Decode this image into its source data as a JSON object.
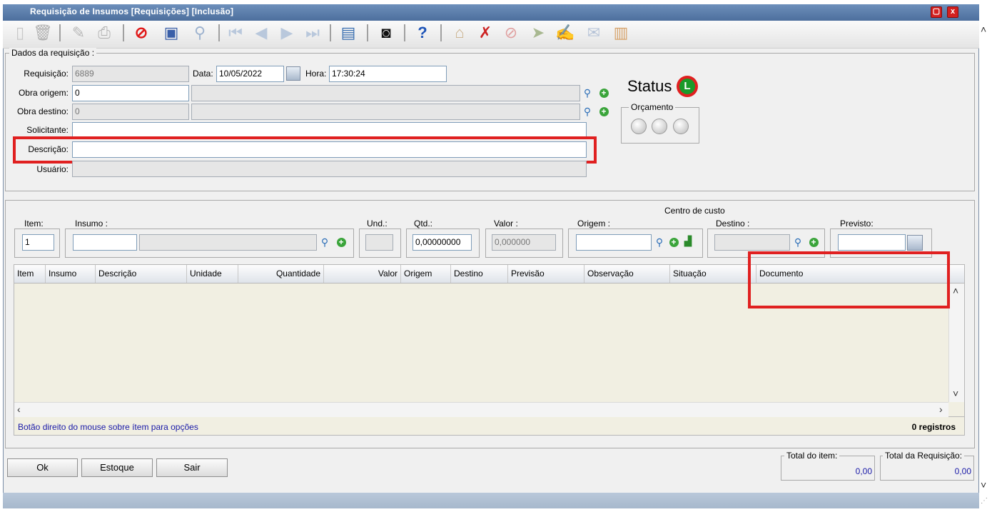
{
  "window": {
    "title": "Requisição de Insumos [Requisições] [Inclusão]",
    "restore_glyph": "▢",
    "close_glyph": "x"
  },
  "toolbar": {
    "icons": [
      "new-doc-icon",
      "trash-icon",
      "edit-icon",
      "print-icon",
      "cancel-icon",
      "save-icon",
      "search-icon",
      "first-record-icon",
      "prev-record-icon",
      "next-record-icon",
      "last-record-icon",
      "report-icon",
      "camera-icon",
      "help-icon",
      "approve-icon",
      "reject-icon",
      "block-icon",
      "forward-icon",
      "sign-icon",
      "mail-icon",
      "chart-icon"
    ]
  },
  "dados": {
    "legend": "Dados da requisição :",
    "requisicao_label": "Requisição:",
    "requisicao_value": "6889",
    "data_label": "Data:",
    "data_value": "10/05/2022",
    "hora_label": "Hora:",
    "hora_value": "17:30:24",
    "obra_origem_label": "Obra origem:",
    "obra_origem_value": "0",
    "obra_destino_label": "Obra destino:",
    "obra_destino_value": "0",
    "solicitante_label": "Solicitante:",
    "descricao_label": "Descrição:",
    "usuario_label": "Usuário:"
  },
  "status": {
    "label": "Status",
    "badge": "L",
    "badge_color": "#1a9a2a",
    "orcamento_legend": "Orçamento"
  },
  "item_entry": {
    "centro_custo_label": "Centro de custo",
    "item_legend": "Item:",
    "item_value": "1",
    "insumo_legend": "Insumo :",
    "und_legend": "Und.:",
    "qtd_legend": "Qtd.:",
    "qtd_value": "0,00000000",
    "valor_legend": "Valor :",
    "valor_value": "0,000000",
    "origem_legend": "Origem :",
    "destino_legend": "Destino :",
    "previsto_legend": "Previsto:"
  },
  "grid": {
    "columns": [
      "Item",
      "Insumo",
      "Descrição",
      "Unidade",
      "Quantidade",
      "Valor",
      "Origem",
      "Destino",
      "Previsão",
      "Observação",
      "Situação",
      "Documento"
    ],
    "footer_hint": "Botão direito do mouse sobre ítem para opções",
    "footer_count": "0 registros"
  },
  "buttons": {
    "ok": "Ok",
    "estoque": "Estoque",
    "sair": "Sair"
  },
  "totals": {
    "item_label": "Total do item:",
    "item_value": "0,00",
    "requisicao_label": "Total da Requisição:",
    "requisicao_value": "0,00"
  },
  "colors": {
    "highlight": "#e02020",
    "titlebar": "#5b7fae",
    "hint_text": "#1a1aa8"
  }
}
